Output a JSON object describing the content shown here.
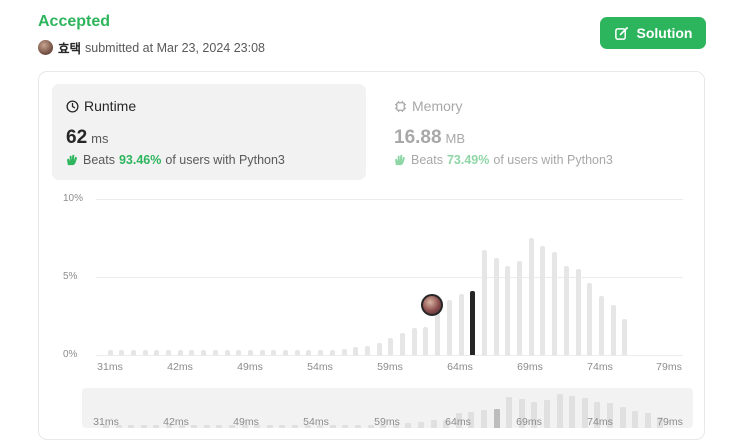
{
  "submission": {
    "status": "Accepted",
    "username": "효택",
    "submitted_text": "submitted at Mar 23, 2024 23:08",
    "solution_label": "Solution"
  },
  "runtime": {
    "label": "Runtime",
    "value": "62",
    "unit": "ms",
    "beats_prefix": "Beats",
    "beats_pct": "93.46%",
    "beats_suffix": "of users with Python3"
  },
  "memory": {
    "label": "Memory",
    "value": "16.88",
    "unit": "MB",
    "beats_prefix": "Beats",
    "beats_pct": "73.49%",
    "beats_suffix": "of users with Python3"
  },
  "chart_data": {
    "type": "bar",
    "y_tick_labels": [
      "10%",
      "5%",
      "0%"
    ],
    "ylim": [
      0,
      10
    ],
    "x": [
      31,
      32,
      33,
      34,
      35,
      36,
      37,
      38,
      39,
      40,
      41,
      42,
      43,
      44,
      45,
      46,
      47,
      48,
      49,
      50,
      51,
      52,
      53,
      54,
      55,
      56,
      57,
      58,
      59,
      60,
      61,
      62,
      63,
      64,
      65,
      66,
      67,
      68,
      69,
      70,
      71,
      72,
      73,
      74,
      75,
      76,
      77,
      78,
      79
    ],
    "values": [
      0.3,
      0.3,
      0.3,
      0.3,
      0.3,
      0.3,
      0.3,
      0.3,
      0.3,
      0.3,
      0.3,
      0.3,
      0.3,
      0.3,
      0.3,
      0.3,
      0.3,
      0.3,
      0.3,
      0.35,
      0.4,
      0.5,
      0.6,
      0.8,
      1.1,
      1.4,
      1.7,
      1.8,
      3.2,
      3.5,
      3.9,
      4.1,
      6.7,
      6.2,
      5.7,
      6.0,
      7.5,
      7.0,
      6.6,
      5.7,
      5.5,
      4.6,
      3.8,
      3.2,
      2.3
    ],
    "selected_x": 62,
    "x_tick_labels": [
      "31ms",
      "42ms",
      "49ms",
      "54ms",
      "59ms",
      "64ms",
      "69ms",
      "74ms",
      "79ms"
    ],
    "mini_x_tick_labels": [
      "31ms",
      "42ms",
      "49ms",
      "54ms",
      "59ms",
      "64ms",
      "69ms",
      "74ms",
      "79ms"
    ],
    "grid": true
  },
  "colors": {
    "accent": "#2db55d",
    "selected_bar": "#262626",
    "bar": "#e6e6e6"
  }
}
